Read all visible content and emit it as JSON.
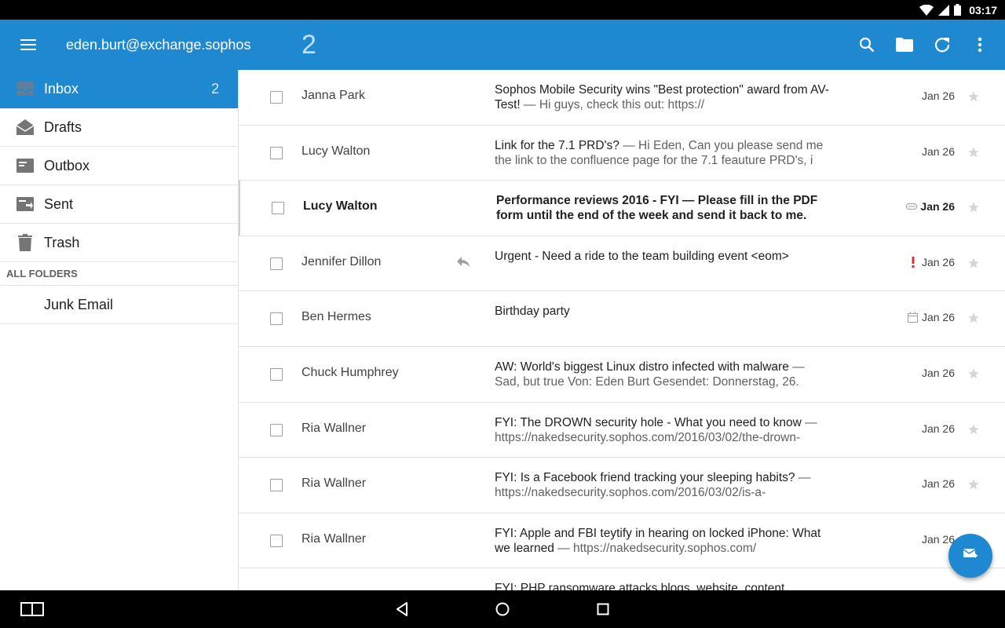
{
  "status_bar": {
    "time": "03:17",
    "icons": [
      "wifi-icon",
      "signal-icon",
      "battery-icon"
    ]
  },
  "app_bar": {
    "account": "eden.burt@exchange.sophos",
    "unread_count": "2",
    "color": "#1e88d1",
    "actions": [
      "search-icon",
      "folder-icon",
      "refresh-icon",
      "more-vert-icon"
    ]
  },
  "sidebar": {
    "folders": [
      {
        "label": "Inbox",
        "count": "2",
        "icon": "inbox-icon",
        "active": true
      },
      {
        "label": "Drafts",
        "count": "",
        "icon": "drafts-icon"
      },
      {
        "label": "Outbox",
        "count": "",
        "icon": "outbox-icon"
      },
      {
        "label": "Sent",
        "count": "",
        "icon": "sent-icon"
      },
      {
        "label": "Trash",
        "count": "",
        "icon": "trash-icon"
      }
    ],
    "section_header": "ALL FOLDERS",
    "sub_folders": [
      {
        "label": "Junk Email"
      }
    ]
  },
  "messages": [
    {
      "sender": "Janna Park",
      "subject": "Sophos Mobile Security wins \"Best protection\" award from AV-Test!",
      "snippet": "Hi guys, check this out: https://",
      "date": "Jan 26",
      "unread": false,
      "flag": ""
    },
    {
      "sender": "Lucy Walton",
      "subject": "Link for the 7.1 PRD's?",
      "snippet": "Hi Eden, Can you please send me the link to the confluence page for the 7.1 feauture PRD's, i",
      "date": "Jan 26",
      "unread": false,
      "flag": ""
    },
    {
      "sender": "Lucy Walton",
      "subject": "Performance reviews 2016 - FYI",
      "snippet": "Please fill in the PDF form until the end of the week and send it back to me.",
      "date": "Jan 26",
      "unread": true,
      "flag": "attachment-icon"
    },
    {
      "sender": "Jennifer Dillon",
      "subject": "Urgent - Need a ride to the team building event <eom>",
      "snippet": "",
      "date": "Jan 26",
      "unread": false,
      "flag": "important-icon",
      "replied": true
    },
    {
      "sender": "Ben Hermes",
      "subject": "Birthday party",
      "snippet": "",
      "date": "Jan 26",
      "unread": false,
      "flag": "calendar-icon"
    },
    {
      "sender": "Chuck Humphrey",
      "subject": "AW: World's biggest Linux distro infected with malware",
      "snippet": "Sad, but true Von: Eden Burt Gesendet: Donnerstag, 26.",
      "date": "Jan 26",
      "unread": false,
      "flag": ""
    },
    {
      "sender": "Ria Wallner",
      "subject": "FYI: The DROWN security hole - What you need to know",
      "snippet": "https://nakedsecurity.sophos.com/2016/03/02/the-drown-",
      "date": "Jan 26",
      "unread": false,
      "flag": ""
    },
    {
      "sender": "Ria Wallner",
      "subject": "FYI: Is a Facebook friend tracking your sleeping habits?",
      "snippet": "https://nakedsecurity.sophos.com/2016/03/02/is-a-",
      "date": "Jan 26",
      "unread": false,
      "flag": ""
    },
    {
      "sender": "Ria Wallner",
      "subject": "FYI: Apple and FBI teytify in hearing on locked iPhone: What we learned",
      "snippet": "https://nakedsecurity.sophos.com/",
      "date": "Jan 26",
      "unread": false,
      "flag": ""
    },
    {
      "sender": "",
      "subject": "FYI: PHP ransomware attacks blogs, website, content",
      "snippet": "",
      "date": "",
      "unread": false,
      "flag": "",
      "partial": true
    }
  ],
  "separator": " — ",
  "fab": {
    "icon": "compose-icon"
  },
  "nav_bar": {
    "buttons": [
      "multiwindow-icon",
      "back-icon",
      "home-icon",
      "recents-icon"
    ]
  }
}
